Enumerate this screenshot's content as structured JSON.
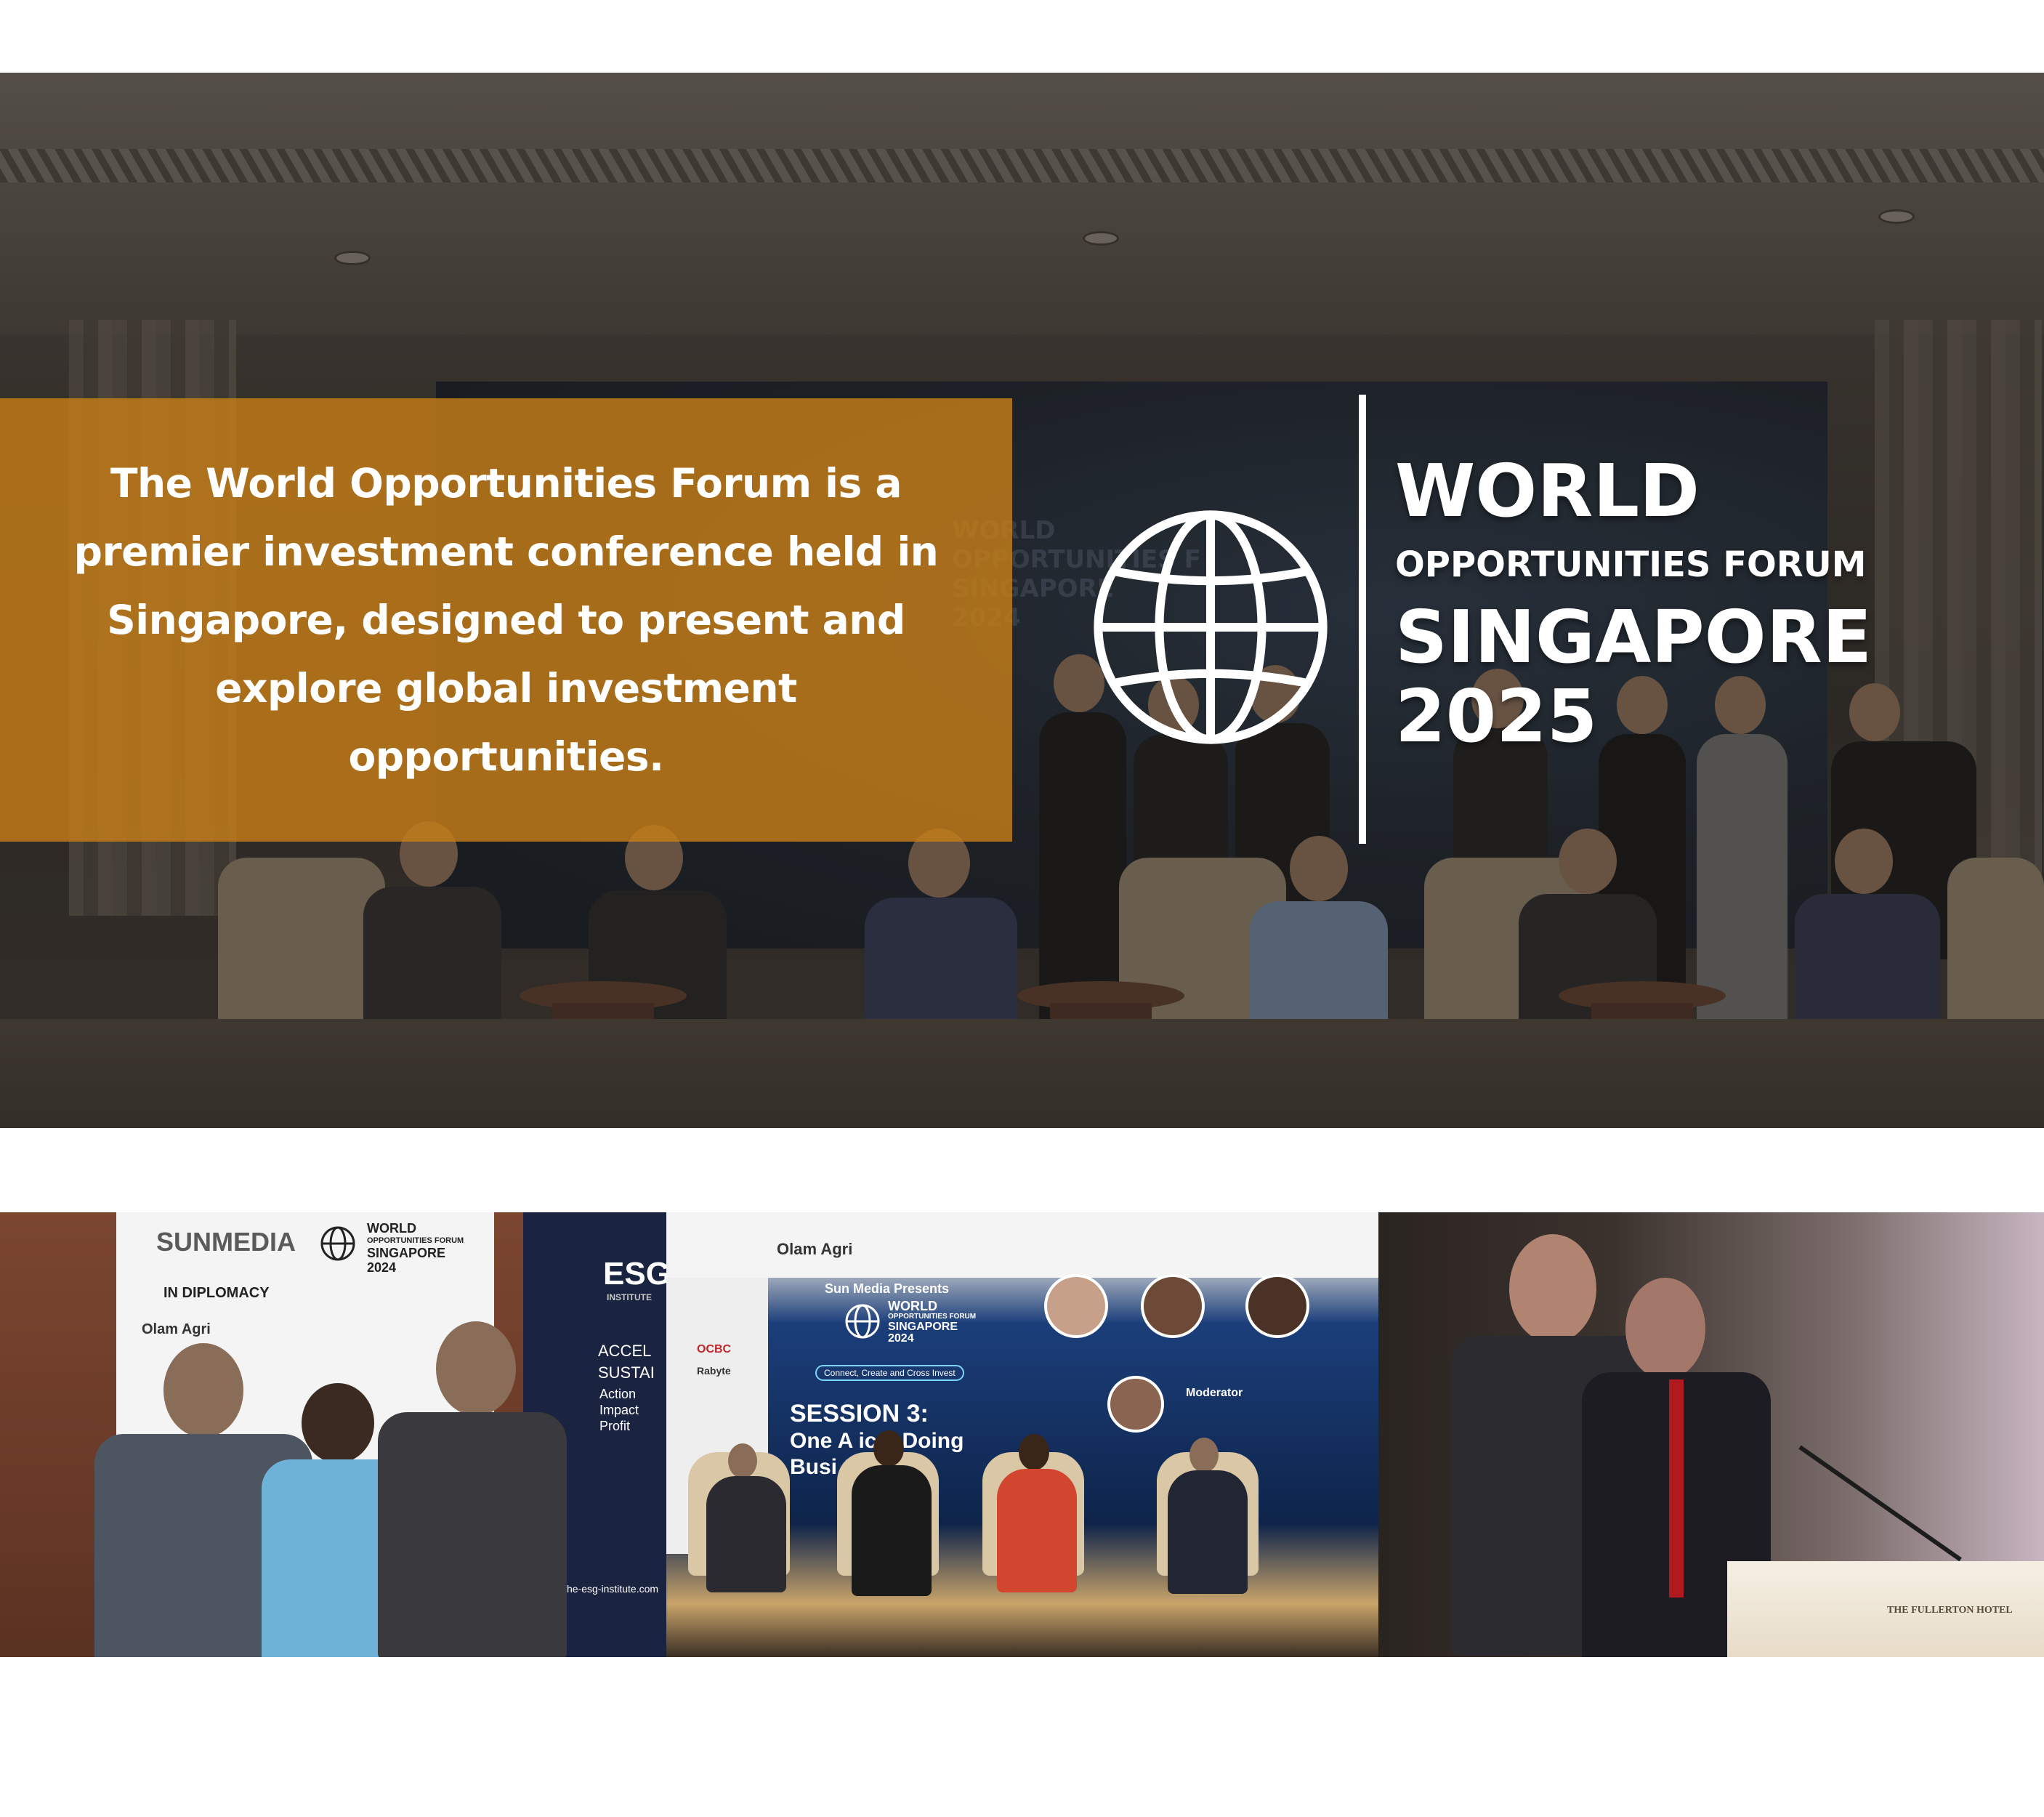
{
  "hero": {
    "description": "The World Opportunities Forum is a premier investment conference held in Singapore, designed to present and explore global investment opportunities.",
    "title": {
      "line1": "WORLD",
      "line2": "OPPORTUNITIES FORUM",
      "line3": "SINGAPORE",
      "line4": "2025"
    },
    "icon": "globe-icon",
    "screen_text": {
      "line1": "WORLD",
      "line2": "OPPORTUNITIES F",
      "line3": "SINGAPORE",
      "line4": "2024"
    },
    "colors": {
      "overlay": "#c67e18",
      "text": "#ffffff"
    }
  },
  "photos": [
    {
      "backdrop": {
        "brand": "SUNMEDIA",
        "brand_sub": "IN DIPLOMACY",
        "forum_line1": "WORLD",
        "forum_line2": "OPPORTUNITIES FORUM",
        "forum_line3": "SINGAPORE",
        "forum_line4": "2024",
        "sponsor": "Olam Agri"
      },
      "side_banner": {
        "logo": "ESG",
        "logo_sub": "INSTITUTE",
        "lines": [
          "ACCEL",
          "SUSTAI",
          "Action",
          "Impact",
          "Profit"
        ],
        "url": "he-esg-institute.com"
      }
    },
    {
      "screen": {
        "sponsor": "Olam Agri",
        "presents": "Sun Media Presents",
        "forum_line1": "WORLD",
        "forum_line2": "OPPORTUNITIES FORUM",
        "forum_line3": "SINGAPORE",
        "forum_line4": "2024",
        "tagline": "Connect, Create and Cross Invest",
        "session": "SESSION 3:",
        "session_title_1": "One A  ica: Doing",
        "session_title_2": "Busi         the      nt",
        "moderator": "Moderator",
        "ocbc": "OCBC",
        "rabyte": "Rabyte"
      }
    },
    {
      "podium_text": "THE FULLERTON HOTEL"
    }
  ]
}
